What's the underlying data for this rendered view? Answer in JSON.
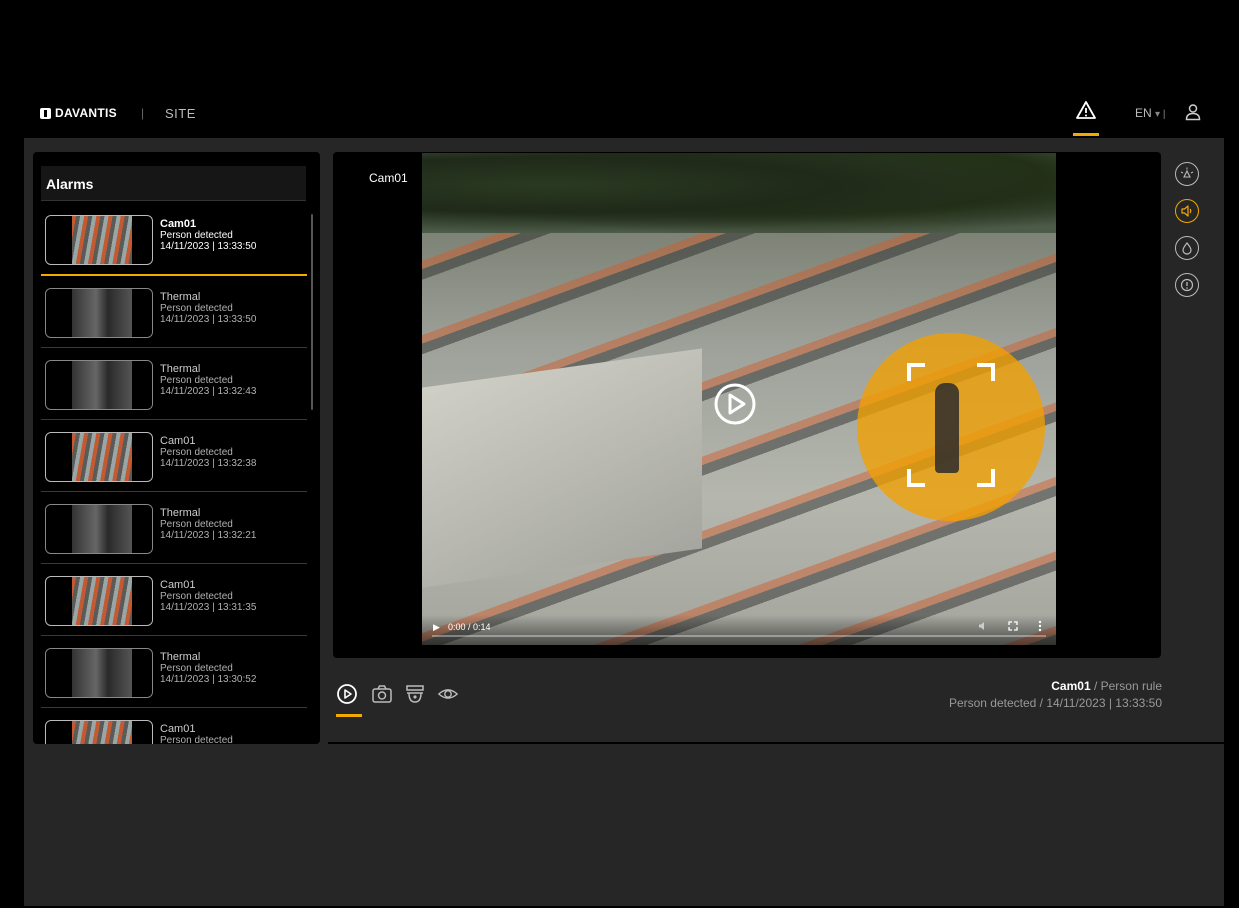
{
  "header": {
    "logo_text": "DAVANTIS",
    "separator": "|",
    "site_label": "SITE",
    "language": "EN",
    "language_caret": "▾ |"
  },
  "alarms": {
    "title": "Alarms",
    "items": [
      {
        "camera": "Cam01",
        "event": "Person detected",
        "timestamp": "14/11/2023 | 13:33:50",
        "selected": true,
        "thumb": "cam"
      },
      {
        "camera": "Thermal",
        "event": "Person detected",
        "timestamp": "14/11/2023 | 13:33:50",
        "thumb": "thermal"
      },
      {
        "camera": "Thermal",
        "event": "Person detected",
        "timestamp": "14/11/2023 | 13:32:43",
        "thumb": "thermal"
      },
      {
        "camera": "Cam01",
        "event": "Person detected",
        "timestamp": "14/11/2023 | 13:32:38",
        "thumb": "cam"
      },
      {
        "camera": "Thermal",
        "event": "Person detected",
        "timestamp": "14/11/2023 | 13:32:21",
        "thumb": "thermal"
      },
      {
        "camera": "Cam01",
        "event": "Person detected",
        "timestamp": "14/11/2023 | 13:31:35",
        "thumb": "cam"
      },
      {
        "camera": "Thermal",
        "event": "Person detected",
        "timestamp": "14/11/2023 | 13:30:52",
        "thumb": "thermal"
      },
      {
        "camera": "Cam01",
        "event": "Person detected",
        "timestamp": "",
        "thumb": "cam"
      }
    ]
  },
  "video": {
    "camera_label": "Cam01",
    "time": "0:00 / 0:14",
    "play_glyph": "▶"
  },
  "event_meta": {
    "camera": "Cam01",
    "rule": " / Person rule",
    "detail": "Person detected / 14/11/2023 | 13:33:50"
  },
  "colors": {
    "accent": "#f2a900",
    "panel_bg": "#262626"
  },
  "side_icons": [
    "light-icon",
    "speaker-icon",
    "water-drop-icon",
    "alert-circle-icon"
  ],
  "tabs": [
    "play-icon",
    "camera-icon",
    "dome-camera-icon",
    "eye-icon"
  ]
}
